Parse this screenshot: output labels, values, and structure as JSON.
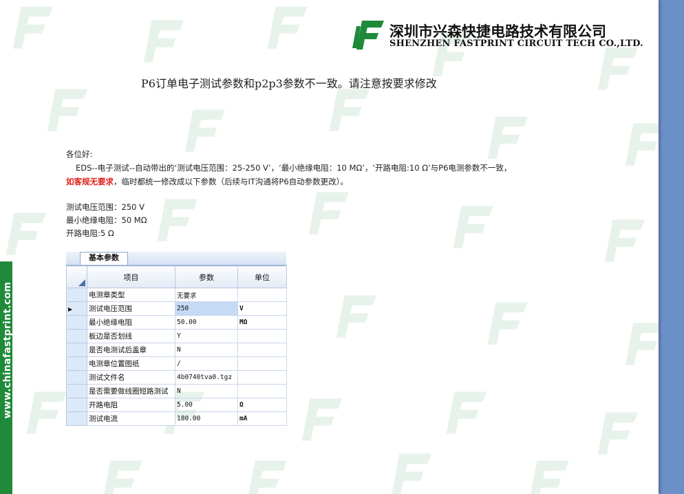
{
  "header": {
    "company_cn": "深圳市兴森快捷电路技术有限公司",
    "company_en": "SHENZHEN FASTPRINT CIRCUIT TECH CO.,LTD.",
    "brand_color": "#1e8a3a"
  },
  "notice": {
    "title": "P6订单电子测试参数和p2p3参数不一致。请注意按要求修改"
  },
  "body": {
    "greeting": "各位好:",
    "line1": "EDS--电子测试--自动带出的‘测试电压范围：25-250 V’，‘最小绝缘电阻：10 MΩ’，‘开路电阻:10 Ω’与P6电测参数不一致，",
    "line2_red": "如客规无要求",
    "line2_rest": "，临时都统一修改成以下参数（后续与IT沟通将P6自动参数更改）。",
    "param1": "测试电压范围：250 V",
    "param2": "最小绝缘电阻：50 MΩ",
    "param3": "开路电阻:5 Ω"
  },
  "grid": {
    "tab_label": "基本参数",
    "columns": [
      "项目",
      "参数",
      "单位"
    ],
    "rows": [
      {
        "item": "电测章类型",
        "value": "无要求",
        "unit": ""
      },
      {
        "item": "测试电压范围",
        "value": "250",
        "unit": "V"
      },
      {
        "item": "最小绝缘电阻",
        "value": "50.00",
        "unit": "MΩ"
      },
      {
        "item": "板边是否划线",
        "value": "Y",
        "unit": ""
      },
      {
        "item": "是否电测试后盖章",
        "value": "N",
        "unit": ""
      },
      {
        "item": "电测章位置图纸",
        "value": "/",
        "unit": ""
      },
      {
        "item": "测试文件名",
        "value": "4b0740tva0.tgz",
        "unit": ""
      },
      {
        "item": "是否需要做线圈短路测试",
        "value": "N",
        "unit": ""
      },
      {
        "item": "开路电阻",
        "value": "5.00",
        "unit": "Ω"
      },
      {
        "item": "测试电流",
        "value": "180.00",
        "unit": "mA"
      }
    ]
  },
  "sidebar": {
    "text": "www.chinafastprint.com"
  }
}
